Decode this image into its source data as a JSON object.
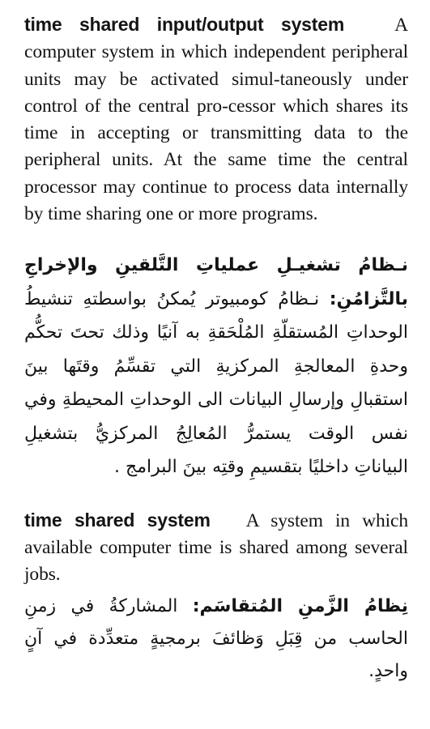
{
  "entries": [
    {
      "term_en": "time shared input/output system",
      "definition_en": "A computer system in which independent peripheral units may be activated simul-taneously under control of the central pro-cessor which shares its time in accepting or transmitting data to the peripheral units. At  the same time the central processor may continue to process data internally by time sharing one or more programs.",
      "term_ar": "نـظامُ تشغيـلِ عملياتِ التَّلقينِ والإخراجِ بالتَّزامُنِ:",
      "definition_ar": "نـظامُ كومبيوتر يُمكنُ بواسطتهِ تنشيطُ الوحداتِ المُستقلّةِ المُلْحَقةِ به آنيًا وذلك تحتَ تحكُّم وحدةِ المعالجةِ المركزيةِ التي تقسِّمُ وقتَها بينَ استقبالِ وإرسالِ البيانات الى الوحداتِ المحيطةِ وفي نفس الوقت يستمرُّ المُعالِجُ المركزيُّ بتشغيلِ البياناتِ داخليًا بتقسيمِ وقتِه بينَ البرامج ."
    },
    {
      "term_en": "time shared system",
      "definition_en": "A system in which available computer time is shared among several jobs.",
      "term_ar": "نِظامُ الزَّمنِ المُتقاسَم:",
      "definition_ar": "المشاركةُ في زمنِ الحاسب من قِبَلِ وَظائفَ برمجيةٍ متعدِّدة في آنٍ واحدٍ."
    }
  ]
}
